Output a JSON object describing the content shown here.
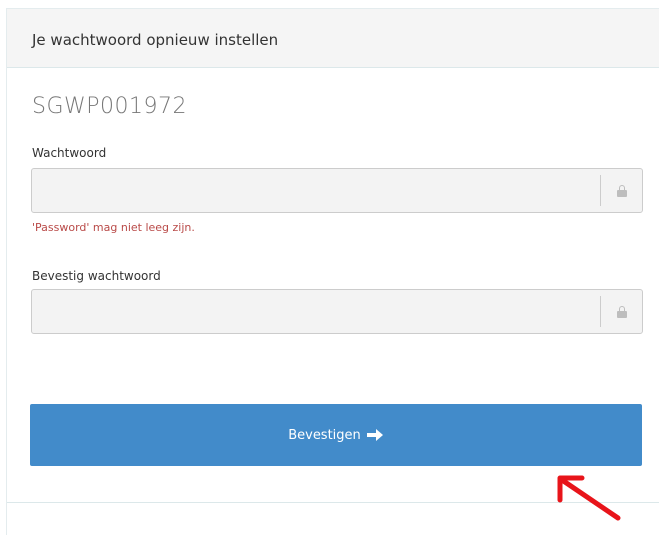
{
  "panel": {
    "title": "Je wachtwoord opnieuw instellen"
  },
  "form": {
    "code": "SGWP001972",
    "password": {
      "label": "Wachtwoord",
      "value": "",
      "error": "'Password' mag niet leeg zijn.",
      "icon": "lock-icon"
    },
    "confirm_password": {
      "label": "Bevestig wachtwoord",
      "value": "",
      "icon": "lock-icon"
    },
    "submit_label": "Bevestigen",
    "submit_icon": "arrow-right-icon"
  },
  "colors": {
    "primary": "#428bca",
    "error": "#b94a48",
    "annotation": "#e8141a"
  }
}
